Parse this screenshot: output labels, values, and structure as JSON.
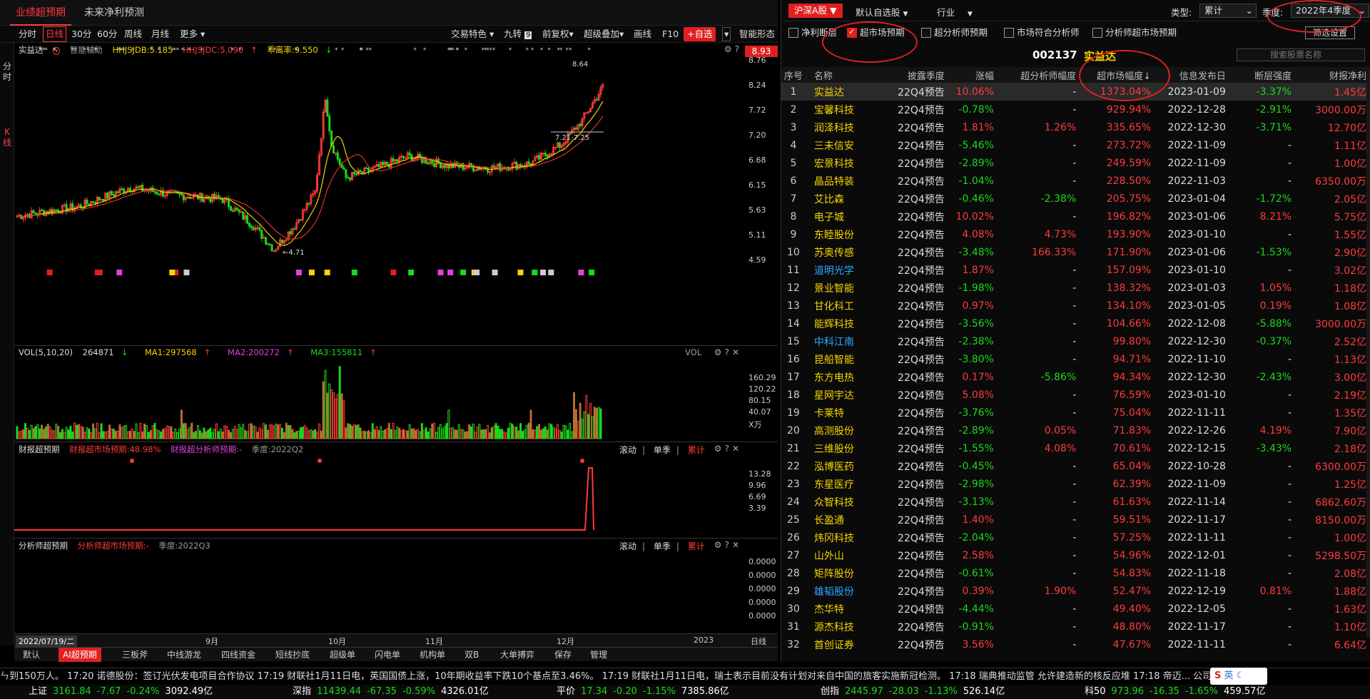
{
  "top_tabs": [
    "业绩超预期",
    "未来净利预测"
  ],
  "toolbar": {
    "periods": [
      "分时",
      "日线",
      "30分",
      "60分",
      "周线",
      "月线",
      "更多"
    ],
    "right": [
      "交易特色",
      "九转",
      "前复权",
      "超级叠加",
      "画线",
      "F10"
    ],
    "add_btn": "+自选",
    "smart": "智能形态"
  },
  "left_strip": {
    "a": "分时",
    "b": "K线"
  },
  "kline": {
    "stock": "实益达",
    "assist": "智能辅助",
    "ind1": "HHJSJDB:5.185",
    "ind2": "HHJSJDC:5.090",
    "ind3": "乖离率:9.550",
    "price_tag": "8.93",
    "axis": [
      "8.76",
      "8.24",
      "7.72",
      "7.20",
      "6.68",
      "6.15",
      "5.63",
      "5.11",
      "4.59"
    ],
    "high_label": "8.64",
    "low_label": "4.71",
    "range_label": "7.21-7.25"
  },
  "vol": {
    "title": "VOL(5,10,20)",
    "v": "264871",
    "ma1": "MA1:297568",
    "ma2": "MA2:200272",
    "ma3": "MA3:155811",
    "axis": [
      "160.29",
      "120.22",
      "80.15",
      "40.07",
      "X万"
    ],
    "label": "VOL"
  },
  "fin": {
    "title": "财报超预期",
    "a": "财报超市场预期:48.98%",
    "b": "财报超分析师预期:-",
    "season": "季度:2022Q2",
    "tabs": [
      "滚动",
      "单季",
      "累计"
    ],
    "axis": [
      "13.28",
      "9.96",
      "6.69",
      "3.39"
    ]
  },
  "ana": {
    "title": "分析师超预期",
    "a": "分析师超市场预期:-",
    "season": "季度:2022Q3",
    "tabs": [
      "滚动",
      "单季",
      "累计"
    ],
    "axis": [
      "0.0000",
      "0.0000",
      "0.0000",
      "0.0000",
      "0.0000"
    ]
  },
  "xaxis": {
    "date": "2022/07/19/二",
    "months": [
      "9月",
      "10月",
      "11月",
      "12月",
      "2023"
    ],
    "right": "日线"
  },
  "chart_tabs": [
    "默认",
    "AI超预期",
    "三板斧",
    "中线游龙",
    "四线资金",
    "短线抄底",
    "超级单",
    "闪电单",
    "机构单",
    "双B",
    "大单搏弈",
    "保存",
    "管理"
  ],
  "right": {
    "market_btn": "沪深A股",
    "watch": "默认自选股",
    "industry": "行业",
    "type_label": "类型:",
    "type_val": "累计",
    "season_label": "季度:",
    "season_val": "2022年4季度",
    "filters": [
      "净利断层",
      "超市场预期",
      "超分析师预期",
      "市场符合分析师",
      "分析师超市场预期"
    ],
    "filter_btn": "筛选设置",
    "code": "002137",
    "name": "实益达",
    "search_placeholder": "搜索股票名称",
    "columns": [
      "序号",
      "名称",
      "披露季度",
      "涨幅",
      "超分析师幅度",
      "超市场幅度",
      "信息发布日",
      "断层强度",
      "财报净利"
    ],
    "rows": [
      [
        "1",
        "实益达",
        "22Q4预告",
        "10.06%",
        "-",
        "1373.04%",
        "2023-01-09",
        "-3.37%",
        "1.45亿"
      ],
      [
        "2",
        "宝馨科技",
        "22Q4预告",
        "-0.78%",
        "-",
        "929.94%",
        "2022-12-28",
        "-2.91%",
        "3000.00万"
      ],
      [
        "3",
        "润泽科技",
        "22Q4预告",
        "1.81%",
        "1.26%",
        "335.65%",
        "2022-12-30",
        "-3.71%",
        "12.70亿"
      ],
      [
        "4",
        "三未信安",
        "22Q4预告",
        "-5.46%",
        "-",
        "273.72%",
        "2022-11-09",
        "-",
        "1.11亿"
      ],
      [
        "5",
        "宏景科技",
        "22Q4预告",
        "-2.89%",
        "-",
        "249.59%",
        "2022-11-09",
        "-",
        "1.00亿"
      ],
      [
        "6",
        "晶品特装",
        "22Q4预告",
        "-1.04%",
        "-",
        "228.50%",
        "2022-11-03",
        "-",
        "6350.00万"
      ],
      [
        "7",
        "艾比森",
        "22Q4预告",
        "-0.46%",
        "-2.38%",
        "205.75%",
        "2023-01-04",
        "-1.72%",
        "2.05亿"
      ],
      [
        "8",
        "电子城",
        "22Q4预告",
        "10.02%",
        "-",
        "196.82%",
        "2023-01-06",
        "8.21%",
        "5.75亿"
      ],
      [
        "9",
        "东睦股份",
        "22Q4预告",
        "4.08%",
        "4.73%",
        "193.90%",
        "2023-01-10",
        "-",
        "1.55亿"
      ],
      [
        "10",
        "苏奥传感",
        "22Q4预告",
        "-3.48%",
        "166.33%",
        "171.90%",
        "2023-01-06",
        "-1.53%",
        "2.90亿"
      ],
      [
        "11",
        "道明光学",
        "22Q4预告",
        "1.87%",
        "-",
        "157.09%",
        "2023-01-10",
        "-",
        "3.02亿"
      ],
      [
        "12",
        "景业智能",
        "22Q4预告",
        "-1.98%",
        "-",
        "138.32%",
        "2023-01-03",
        "1.05%",
        "1.18亿"
      ],
      [
        "13",
        "甘化科工",
        "22Q4预告",
        "0.97%",
        "-",
        "134.10%",
        "2023-01-05",
        "0.19%",
        "1.08亿"
      ],
      [
        "14",
        "能辉科技",
        "22Q4预告",
        "-3.56%",
        "-",
        "104.66%",
        "2022-12-08",
        "-5.88%",
        "3000.00万"
      ],
      [
        "15",
        "中科江南",
        "22Q4预告",
        "-2.38%",
        "-",
        "99.80%",
        "2022-12-30",
        "-0.37%",
        "2.52亿"
      ],
      [
        "16",
        "昆船智能",
        "22Q4预告",
        "-3.80%",
        "-",
        "94.71%",
        "2022-11-10",
        "-",
        "1.13亿"
      ],
      [
        "17",
        "东方电热",
        "22Q4预告",
        "0.17%",
        "-5.86%",
        "94.34%",
        "2022-12-30",
        "-2.43%",
        "3.00亿"
      ],
      [
        "18",
        "星网宇达",
        "22Q4预告",
        "5.08%",
        "-",
        "76.59%",
        "2023-01-10",
        "-",
        "2.19亿"
      ],
      [
        "19",
        "卡莱特",
        "22Q4预告",
        "-3.76%",
        "-",
        "75.04%",
        "2022-11-11",
        "-",
        "1.35亿"
      ],
      [
        "20",
        "高测股份",
        "22Q4预告",
        "-2.89%",
        "0.05%",
        "71.83%",
        "2022-12-26",
        "4.19%",
        "7.90亿"
      ],
      [
        "21",
        "三维股份",
        "22Q4预告",
        "-1.55%",
        "4.08%",
        "70.61%",
        "2022-12-15",
        "-3.43%",
        "2.18亿"
      ],
      [
        "22",
        "泓博医药",
        "22Q4预告",
        "-0.45%",
        "-",
        "65.04%",
        "2022-10-28",
        "-",
        "6300.00万"
      ],
      [
        "23",
        "东星医疗",
        "22Q4预告",
        "-2.98%",
        "-",
        "62.39%",
        "2022-11-09",
        "-",
        "1.25亿"
      ],
      [
        "24",
        "众智科技",
        "22Q4预告",
        "-3.13%",
        "-",
        "61.63%",
        "2022-11-14",
        "-",
        "6862.60万"
      ],
      [
        "25",
        "长盈通",
        "22Q4预告",
        "1.40%",
        "-",
        "59.51%",
        "2022-11-17",
        "-",
        "8150.00万"
      ],
      [
        "26",
        "炜冈科技",
        "22Q4预告",
        "-2.04%",
        "-",
        "57.25%",
        "2022-11-11",
        "-",
        "1.00亿"
      ],
      [
        "27",
        "山外山",
        "22Q4预告",
        "2.58%",
        "-",
        "54.96%",
        "2022-12-01",
        "-",
        "5298.50万"
      ],
      [
        "28",
        "矩阵股份",
        "22Q4预告",
        "-0.61%",
        "-",
        "54.83%",
        "2022-11-18",
        "-",
        "2.08亿"
      ],
      [
        "29",
        "雄韬股份",
        "22Q4预告",
        "0.39%",
        "1.90%",
        "52.47%",
        "2022-12-19",
        "0.81%",
        "1.88亿"
      ],
      [
        "30",
        "杰华特",
        "22Q4预告",
        "-4.44%",
        "-",
        "49.40%",
        "2022-12-05",
        "-",
        "1.63亿"
      ],
      [
        "31",
        "源杰科技",
        "22Q4预告",
        "-0.91%",
        "-",
        "48.80%",
        "2022-11-17",
        "-",
        "1.10亿"
      ],
      [
        "32",
        "首创证券",
        "22Q4预告",
        "3.56%",
        "-",
        "47.67%",
        "2022-11-11",
        "-",
        "6.64亿"
      ]
    ]
  },
  "ticker": "ㄣ到150万人。    17:20 诺德股份：签订光伏发电项目合作协议       17:19 财联社1月11日电，英国国债上涨，10年期收益率下跌10个基点至3.46%。        17:19 财联社1月11日电，瑞士表示目前没有计划对来自中国的旅客实施新冠检测。        17:18 瑞典推动监管 允许建造新的核反应堆        17:18 帝迈...  公司及控股27...",
  "indices": [
    {
      "name": "上证",
      "val": "3161.84",
      "chg": "-7.67",
      "pct": "-0.24%",
      "amt": "3092.49亿"
    },
    {
      "name": "深指",
      "val": "11439.44",
      "chg": "-67.35",
      "pct": "-0.59%",
      "amt": "4326.01亿"
    },
    {
      "name": "平价",
      "val": "17.34",
      "chg": "-0.20",
      "pct": "-1.15%",
      "amt": "7385.86亿"
    },
    {
      "name": "创指",
      "val": "2445.97",
      "chg": "-28.03",
      "pct": "-1.13%",
      "amt": "526.14亿"
    },
    {
      "name": "科50",
      "val": "973.96",
      "chg": "-16.35",
      "pct": "-1.65%",
      "amt": "459.57亿"
    }
  ],
  "ime": "英"
}
